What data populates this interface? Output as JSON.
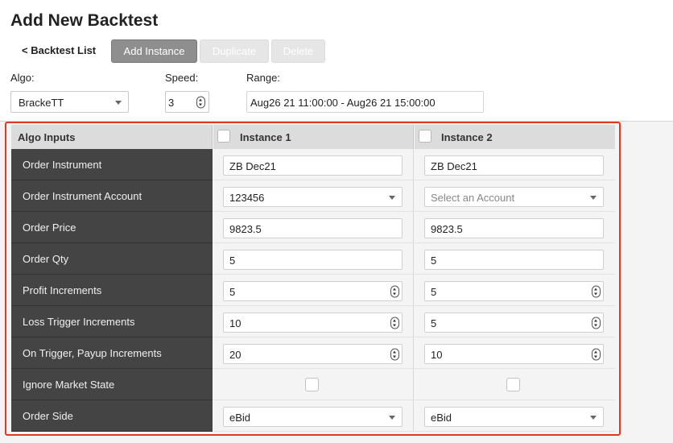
{
  "page": {
    "title": "Add New Backtest",
    "back_link": "< Backtest List"
  },
  "toolbar": {
    "add_instance": "Add Instance",
    "duplicate": "Duplicate",
    "delete": "Delete"
  },
  "settings": {
    "algo_label": "Algo:",
    "algo_value": "BrackeTT",
    "speed_label": "Speed:",
    "speed_value": "3",
    "range_label": "Range:",
    "range_value": "Aug26 21 11:00:00 - Aug26 21 15:00:00"
  },
  "grid": {
    "header": {
      "algo_inputs": "Algo Inputs",
      "instance1": "Instance 1",
      "instance2": "Instance 2"
    },
    "rows": [
      {
        "label": "Order Instrument",
        "type": "text",
        "v1": "ZB Dec21",
        "v2": "ZB Dec21"
      },
      {
        "label": "Order Instrument Account",
        "type": "select",
        "v1": "123456",
        "v2": "Select an Account"
      },
      {
        "label": "Order Price",
        "type": "text",
        "v1": "9823.5",
        "v2": "9823.5"
      },
      {
        "label": "Order Qty",
        "type": "text",
        "v1": "5",
        "v2": "5"
      },
      {
        "label": "Profit Increments",
        "type": "number",
        "v1": "5",
        "v2": "5"
      },
      {
        "label": "Loss Trigger Increments",
        "type": "number",
        "v1": "10",
        "v2": "5"
      },
      {
        "label": "On Trigger, Payup Increments",
        "type": "number",
        "v1": "20",
        "v2": "10"
      },
      {
        "label": "Ignore Market State",
        "type": "checkbox",
        "v1": false,
        "v2": false
      },
      {
        "label": "Order Side",
        "type": "select",
        "v1": "eBid",
        "v2": "eBid"
      }
    ]
  },
  "colors": {
    "highlight_border": "#e23a1e",
    "label_column_bg": "#444444",
    "header_bg": "#dcdcdc"
  }
}
